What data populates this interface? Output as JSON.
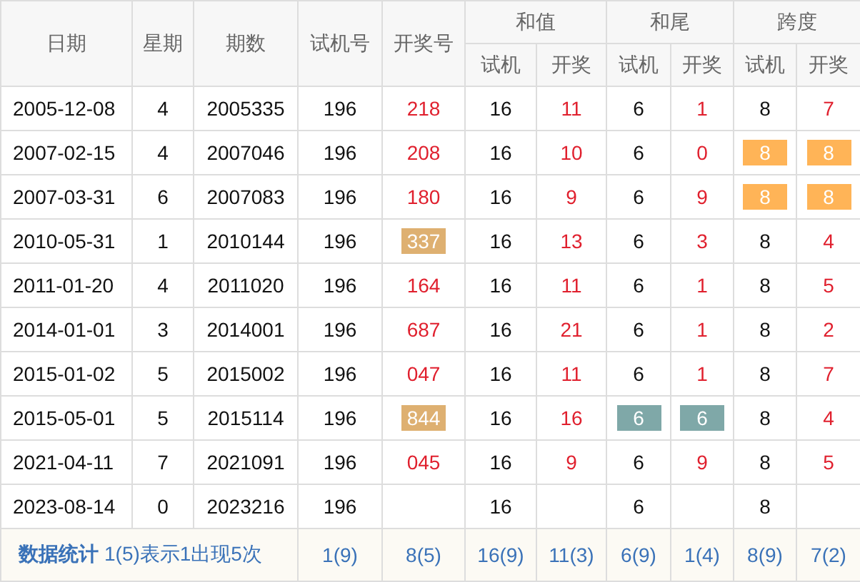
{
  "table": {
    "columns": [
      {
        "label": "日期"
      },
      {
        "label": "星期"
      },
      {
        "label": "期数"
      },
      {
        "label": "试机号"
      },
      {
        "label": "开奖号"
      }
    ],
    "groups": [
      {
        "label": "和值",
        "sub": [
          "试机",
          "开奖"
        ]
      },
      {
        "label": "和尾",
        "sub": [
          "试机",
          "开奖"
        ]
      },
      {
        "label": "跨度",
        "sub": [
          "试机",
          "开奖"
        ]
      }
    ],
    "rows": [
      {
        "date": "2005-12-08",
        "weekday": "4",
        "issue": "2005335",
        "trial": "196",
        "draw": {
          "value": "218",
          "highlighted": false
        },
        "sum_trial": {
          "value": "16",
          "highlighted": false
        },
        "sum_draw": {
          "value": "11",
          "highlighted": false
        },
        "tail_trial": {
          "value": "6",
          "highlighted": false
        },
        "tail_draw": {
          "value": "1",
          "highlighted": false
        },
        "span_trial": {
          "value": "8",
          "highlighted": false
        },
        "span_draw": {
          "value": "7",
          "highlighted": false
        }
      },
      {
        "date": "2007-02-15",
        "weekday": "4",
        "issue": "2007046",
        "trial": "196",
        "draw": {
          "value": "208",
          "highlighted": false
        },
        "sum_trial": {
          "value": "16",
          "highlighted": false
        },
        "sum_draw": {
          "value": "10",
          "highlighted": false
        },
        "tail_trial": {
          "value": "6",
          "highlighted": false
        },
        "tail_draw": {
          "value": "0",
          "highlighted": false
        },
        "span_trial": {
          "value": "8",
          "highlighted": true,
          "color": "#ffb457"
        },
        "span_draw": {
          "value": "8",
          "highlighted": true,
          "color": "#ffb457"
        }
      },
      {
        "date": "2007-03-31",
        "weekday": "6",
        "issue": "2007083",
        "trial": "196",
        "draw": {
          "value": "180",
          "highlighted": false
        },
        "sum_trial": {
          "value": "16",
          "highlighted": false
        },
        "sum_draw": {
          "value": "9",
          "highlighted": false
        },
        "tail_trial": {
          "value": "6",
          "highlighted": false
        },
        "tail_draw": {
          "value": "9",
          "highlighted": false
        },
        "span_trial": {
          "value": "8",
          "highlighted": true,
          "color": "#ffb457"
        },
        "span_draw": {
          "value": "8",
          "highlighted": true,
          "color": "#ffb457"
        }
      },
      {
        "date": "2010-05-31",
        "weekday": "1",
        "issue": "2010144",
        "trial": "196",
        "draw": {
          "value": "337",
          "highlighted": true,
          "color": "#deb071"
        },
        "sum_trial": {
          "value": "16",
          "highlighted": false
        },
        "sum_draw": {
          "value": "13",
          "highlighted": false
        },
        "tail_trial": {
          "value": "6",
          "highlighted": false
        },
        "tail_draw": {
          "value": "3",
          "highlighted": false
        },
        "span_trial": {
          "value": "8",
          "highlighted": false
        },
        "span_draw": {
          "value": "4",
          "highlighted": false
        }
      },
      {
        "date": "2011-01-20",
        "weekday": "4",
        "issue": "2011020",
        "trial": "196",
        "draw": {
          "value": "164",
          "highlighted": false
        },
        "sum_trial": {
          "value": "16",
          "highlighted": false
        },
        "sum_draw": {
          "value": "11",
          "highlighted": false
        },
        "tail_trial": {
          "value": "6",
          "highlighted": false
        },
        "tail_draw": {
          "value": "1",
          "highlighted": false
        },
        "span_trial": {
          "value": "8",
          "highlighted": false
        },
        "span_draw": {
          "value": "5",
          "highlighted": false
        }
      },
      {
        "date": "2014-01-01",
        "weekday": "3",
        "issue": "2014001",
        "trial": "196",
        "draw": {
          "value": "687",
          "highlighted": false
        },
        "sum_trial": {
          "value": "16",
          "highlighted": false
        },
        "sum_draw": {
          "value": "21",
          "highlighted": false
        },
        "tail_trial": {
          "value": "6",
          "highlighted": false
        },
        "tail_draw": {
          "value": "1",
          "highlighted": false
        },
        "span_trial": {
          "value": "8",
          "highlighted": false
        },
        "span_draw": {
          "value": "2",
          "highlighted": false
        }
      },
      {
        "date": "2015-01-02",
        "weekday": "5",
        "issue": "2015002",
        "trial": "196",
        "draw": {
          "value": "047",
          "highlighted": false
        },
        "sum_trial": {
          "value": "16",
          "highlighted": false
        },
        "sum_draw": {
          "value": "11",
          "highlighted": false
        },
        "tail_trial": {
          "value": "6",
          "highlighted": false
        },
        "tail_draw": {
          "value": "1",
          "highlighted": false
        },
        "span_trial": {
          "value": "8",
          "highlighted": false
        },
        "span_draw": {
          "value": "7",
          "highlighted": false
        }
      },
      {
        "date": "2015-05-01",
        "weekday": "5",
        "issue": "2015114",
        "trial": "196",
        "draw": {
          "value": "844",
          "highlighted": true,
          "color": "#deb071"
        },
        "sum_trial": {
          "value": "16",
          "highlighted": false
        },
        "sum_draw": {
          "value": "16",
          "highlighted": false
        },
        "tail_trial": {
          "value": "6",
          "highlighted": true,
          "color": "#7fa8a8"
        },
        "tail_draw": {
          "value": "6",
          "highlighted": true,
          "color": "#7fa8a8"
        },
        "span_trial": {
          "value": "8",
          "highlighted": false
        },
        "span_draw": {
          "value": "4",
          "highlighted": false
        }
      },
      {
        "date": "2021-04-11",
        "weekday": "7",
        "issue": "2021091",
        "trial": "196",
        "draw": {
          "value": "045",
          "highlighted": false
        },
        "sum_trial": {
          "value": "16",
          "highlighted": false
        },
        "sum_draw": {
          "value": "9",
          "highlighted": false
        },
        "tail_trial": {
          "value": "6",
          "highlighted": false
        },
        "tail_draw": {
          "value": "9",
          "highlighted": false
        },
        "span_trial": {
          "value": "8",
          "highlighted": false
        },
        "span_draw": {
          "value": "5",
          "highlighted": false
        }
      },
      {
        "date": "2023-08-14",
        "weekday": "0",
        "issue": "2023216",
        "trial": "196",
        "sum_trial": {
          "value": "16",
          "highlighted": false
        },
        "tail_trial": {
          "value": "6",
          "highlighted": false
        },
        "span_trial": {
          "value": "8",
          "highlighted": false
        }
      }
    ],
    "footer": {
      "label": "数据统计",
      "note": "1(5)表示1出现5次",
      "stats": [
        "1(9)",
        "8(5)",
        "16(9)",
        "11(3)",
        "6(9)",
        "1(4)",
        "8(9)",
        "7(2)"
      ]
    }
  }
}
